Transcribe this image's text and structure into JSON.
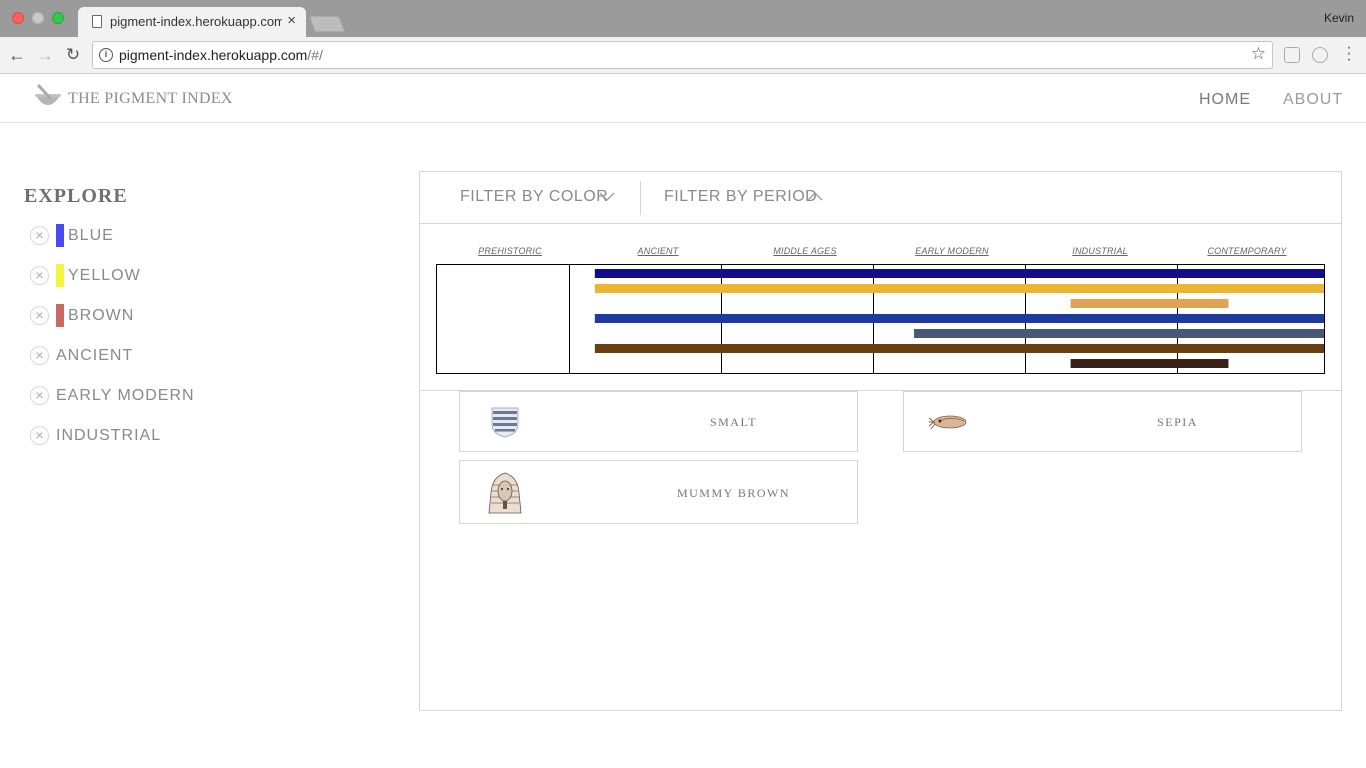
{
  "browser": {
    "tab_title": "pigment-index.herokuapp.com/#/",
    "tab_close": "×",
    "user": "Kevin",
    "url_host": "pigment-index.herokuapp.com",
    "url_path": "/#/"
  },
  "site": {
    "logo_text": "THE PIGMENT INDEX",
    "nav": {
      "home": "HOME",
      "about": "ABOUT"
    }
  },
  "sidebar": {
    "title": "EXPLORE",
    "filters": [
      {
        "label": "BLUE",
        "swatch": "#4a4af0"
      },
      {
        "label": "YELLOW",
        "swatch": "#f5f540"
      },
      {
        "label": "BROWN",
        "swatch": "#c86a63"
      },
      {
        "label": "ANCIENT"
      },
      {
        "label": "EARLY MODERN"
      },
      {
        "label": "INDUSTRIAL"
      }
    ],
    "remove_glyph": "×"
  },
  "filter_bar": {
    "by_color": "FILTER BY COLOR",
    "by_period": "FILTER BY PERIOD"
  },
  "timeline": {
    "periods": [
      "PREHISTORIC",
      "ANCIENT",
      "MIDDLE AGES",
      "EARLY MODERN",
      "INDUSTRIAL",
      "CONTEMPORARY"
    ],
    "bars": [
      {
        "start": 1.17,
        "end": 6.0,
        "color": "#100e8a"
      },
      {
        "start": 1.17,
        "end": 6.0,
        "color": "#ecb730"
      },
      {
        "start": 4.3,
        "end": 5.35,
        "color": "#e1a255"
      },
      {
        "start": 1.17,
        "end": 6.0,
        "color": "#1e3a9e"
      },
      {
        "start": 3.27,
        "end": 6.0,
        "color": "#4a5878"
      },
      {
        "start": 1.17,
        "end": 6.0,
        "color": "#6b4010"
      },
      {
        "start": 4.3,
        "end": 5.35,
        "color": "#3a2116"
      }
    ]
  },
  "cards": [
    {
      "name": "SMALT",
      "icon": "striped-shield-icon"
    },
    {
      "name": "SEPIA",
      "icon": "cuttlefish-icon"
    },
    {
      "name": "MUMMY BROWN",
      "icon": "pharaoh-mask-icon"
    }
  ]
}
